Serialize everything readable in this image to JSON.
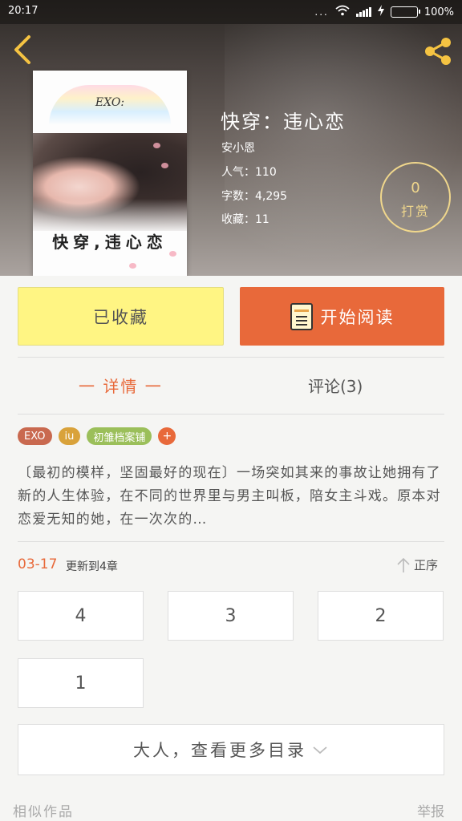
{
  "status_bar": {
    "time": "20:17",
    "dots": "...",
    "battery": "100%",
    "battery_level": 1.0
  },
  "book": {
    "title": "快穿：违心恋",
    "author": "安小恩",
    "popularity": "人气：110",
    "word_count": "字数：4,295",
    "favorites": "收藏：11",
    "cover": {
      "brand": "EXO:",
      "title": "快穿,违心恋"
    }
  },
  "tip": {
    "count": "0",
    "label": "打赏",
    "color": "#f0d78c"
  },
  "actions": {
    "collected_label": "已收藏",
    "read_label": "开始阅读"
  },
  "tabs": {
    "details": "一 详情 一",
    "comments": "评论(3)"
  },
  "tags": [
    {
      "label": "EXO",
      "color": "#c9694f"
    },
    {
      "label": "iu",
      "color": "#d9a23a"
    },
    {
      "label": "初雏档案铺",
      "color": "#9bbf5a"
    }
  ],
  "tag_add": "+",
  "summary": "〔最初的模样，坚固最好的现在〕一场突如其来的事故让她拥有了新的人生体验，在不同的世界里与男主叫板，陪女主斗戏。原本对恋爱无知的她，在一次次的…",
  "update": {
    "date": "03-17",
    "text": "更新到4章",
    "sort_label": "正序"
  },
  "chapters": [
    "4",
    "3",
    "2",
    "1"
  ],
  "more_toc": "大人，查看更多目录",
  "footer": {
    "similar": "相似作品",
    "report": "举报"
  },
  "colors": {
    "accent": "#e8693a",
    "collect_bg": "#fff583"
  }
}
